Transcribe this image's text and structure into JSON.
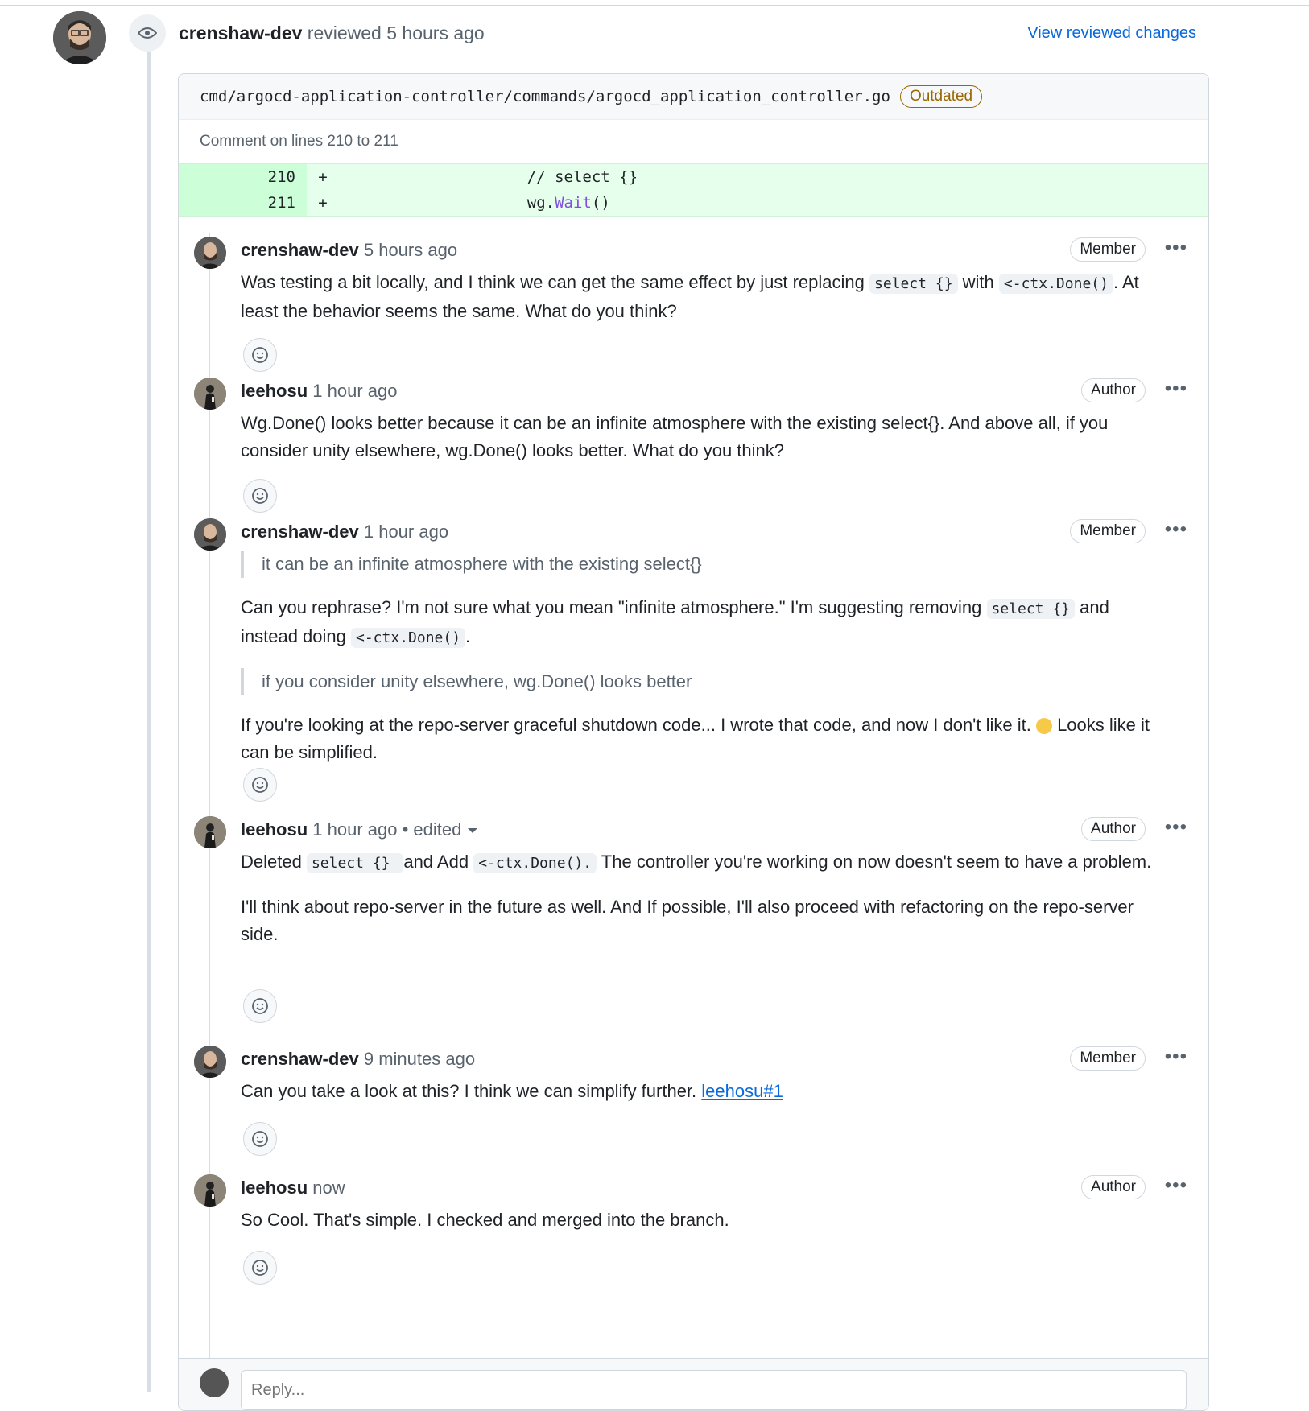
{
  "review": {
    "reviewer": "crenshaw-dev",
    "action": "reviewed",
    "time": "5 hours ago",
    "view_changes_label": "View reviewed changes"
  },
  "file": {
    "path": "cmd/argocd-application-controller/commands/argocd_application_controller.go",
    "badge": "Outdated",
    "comment_lines": "Comment on lines 210 to 211",
    "diff": [
      {
        "line": "210",
        "sign": "+",
        "code_prefix": "                    // select {}",
        "code_fn": "",
        "code_suffix": ""
      },
      {
        "line": "211",
        "sign": "+",
        "code_prefix": "                    wg.",
        "code_fn": "Wait",
        "code_suffix": "()"
      }
    ]
  },
  "comments": [
    {
      "author": "crenshaw-dev",
      "time": "5 hours ago",
      "role": "Member",
      "t1": "Was testing a bit locally, and I think we can get the same effect by just replacing ",
      "c1": "select {}",
      "t2": " with ",
      "c2": "<-ctx.Done()",
      "t3": ". At least the behavior seems the same. What do you think?"
    },
    {
      "author": "leehosu",
      "time": "1 hour ago",
      "role": "Author",
      "text": "Wg.Done() looks better because it can be an infinite atmosphere with the existing select{}. And above all, if you consider unity elsewhere, wg.Done() looks better. What do you think?"
    },
    {
      "author": "crenshaw-dev",
      "time": "1 hour ago",
      "role": "Member",
      "quote1": "it can be an infinite atmosphere with the existing select{}",
      "t1": "Can you rephrase? I'm not sure what you mean \"infinite atmosphere.\" I'm suggesting removing ",
      "c1": "select {}",
      "t2": " and instead doing ",
      "c2": "<-ctx.Done()",
      "t3": ".",
      "quote2": "if you consider unity elsewhere, wg.Done() looks better",
      "t4": "If you're looking at the repo-server graceful shutdown code... I wrote that code, and now I don't like it. ",
      "t5": " Looks like it can be simplified."
    },
    {
      "author": "leehosu",
      "time": "1 hour ago",
      "edited": "• edited",
      "role": "Author",
      "t1": "Deleted ",
      "c1": "select {} ",
      "t2": " and Add ",
      "c2": "<-ctx.Done().",
      "t3": " The controller you're working on now doesn't seem to have a problem.",
      "p2": "I'll think about repo-server in the future as well. And If possible, I'll also proceed with refactoring on the repo-server side."
    },
    {
      "author": "crenshaw-dev",
      "time": "9 minutes ago",
      "role": "Member",
      "text": "Can you take a look at this? I think we can simplify further. ",
      "link": "leehosu#1"
    },
    {
      "author": "leehosu",
      "time": "now",
      "role": "Author",
      "text": "So Cool. That's simple. I checked and merged into the branch."
    }
  ],
  "reply": {
    "placeholder": "Reply..."
  },
  "menu_glyph": "•••"
}
